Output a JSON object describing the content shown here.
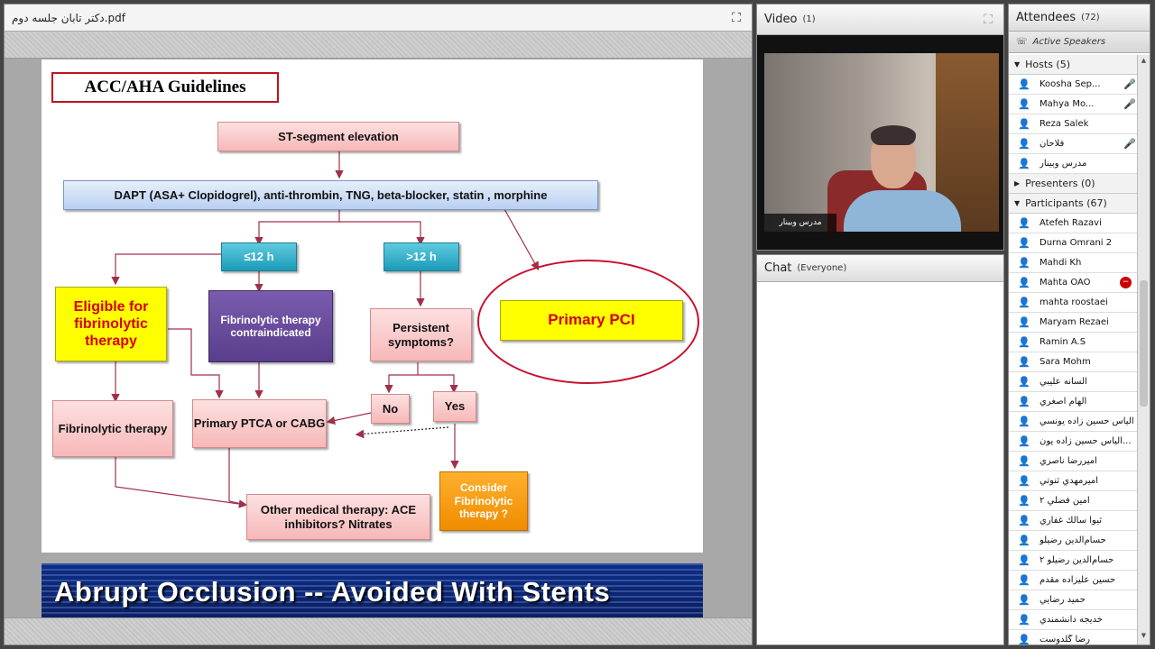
{
  "share": {
    "file_title": "دکتر تابان جلسه دوم.pdf",
    "fullscreen_icon": "fullscreen-icon"
  },
  "slide": {
    "title": "ACC/AHA Guidelines",
    "boxes": {
      "st": "ST-segment elevation",
      "dapt": "DAPT (ASA+ Clopidogrel), anti-thrombin, TNG, beta-blocker, statin , morphine",
      "le12": "≤12 h",
      "gt12": ">12 h",
      "eligible": "Eligible for fibrinolytic therapy",
      "contra": "Fibrinolytic therapy contraindicated",
      "persistent": "Persistent symptoms?",
      "pci": "Primary PCI",
      "no": "No",
      "yes": "Yes",
      "fibrinolytic": "Fibrinolytic therapy",
      "ptca": "Primary PTCA or CABG",
      "consider": "Consider Fibrinolytic therapy ?",
      "other": "Other medical therapy: ACE inhibitors? Nitrates"
    },
    "next_slide_title": "Abrupt Occlusion -- Avoided With Stents"
  },
  "video": {
    "title": "Video",
    "count": "(1)",
    "presenter_name": "مدرس وبینار"
  },
  "chat": {
    "title": "Chat",
    "scope": "(Everyone)"
  },
  "attendees": {
    "title": "Attendees",
    "count": "(72)",
    "active_speakers": "Active Speakers",
    "groups": {
      "hosts": "Hosts (5)",
      "presenters": "Presenters (0)",
      "participants": "Participants (67)"
    },
    "hosts": [
      {
        "name": "Koosha Sep...",
        "status": "mic"
      },
      {
        "name": "Mahya Mo...",
        "status": "mic"
      },
      {
        "name": "Reza Salek",
        "status": ""
      },
      {
        "name": "فلاحان",
        "status": "mic"
      },
      {
        "name": "مدرس وبینار",
        "status": ""
      }
    ],
    "participants": [
      {
        "name": "Atefeh Razavi",
        "status": ""
      },
      {
        "name": "Durna Omrani 2",
        "status": ""
      },
      {
        "name": "Mahdi Kh",
        "status": ""
      },
      {
        "name": "Mahta OAO",
        "status": "block"
      },
      {
        "name": "mahta roostaei",
        "status": ""
      },
      {
        "name": "Maryam Rezaei",
        "status": ""
      },
      {
        "name": "Ramin A.S",
        "status": ""
      },
      {
        "name": "Sara Mohm",
        "status": ""
      },
      {
        "name": "السانه عليبي",
        "status": ""
      },
      {
        "name": "الهام اصغري",
        "status": ""
      },
      {
        "name": "الياس حسين زاده يونسي",
        "status": ""
      },
      {
        "name": "الياس حسين زاده يون...",
        "status": ""
      },
      {
        "name": "اميررضا ناصري",
        "status": ""
      },
      {
        "name": "اميرمهدي ثنوتي",
        "status": ""
      },
      {
        "name": "امين فضلي ٢",
        "status": ""
      },
      {
        "name": "ثيوا سالك غفاري",
        "status": ""
      },
      {
        "name": "حسام‌الدين رضيلو",
        "status": ""
      },
      {
        "name": "حسام‌الدين رضيلو ٢",
        "status": ""
      },
      {
        "name": "حسين عليزاده مقدم",
        "status": ""
      },
      {
        "name": "حميد رضايي",
        "status": ""
      },
      {
        "name": "خديجه دانشمندي",
        "status": ""
      },
      {
        "name": "رضا گلدوست",
        "status": ""
      }
    ]
  }
}
